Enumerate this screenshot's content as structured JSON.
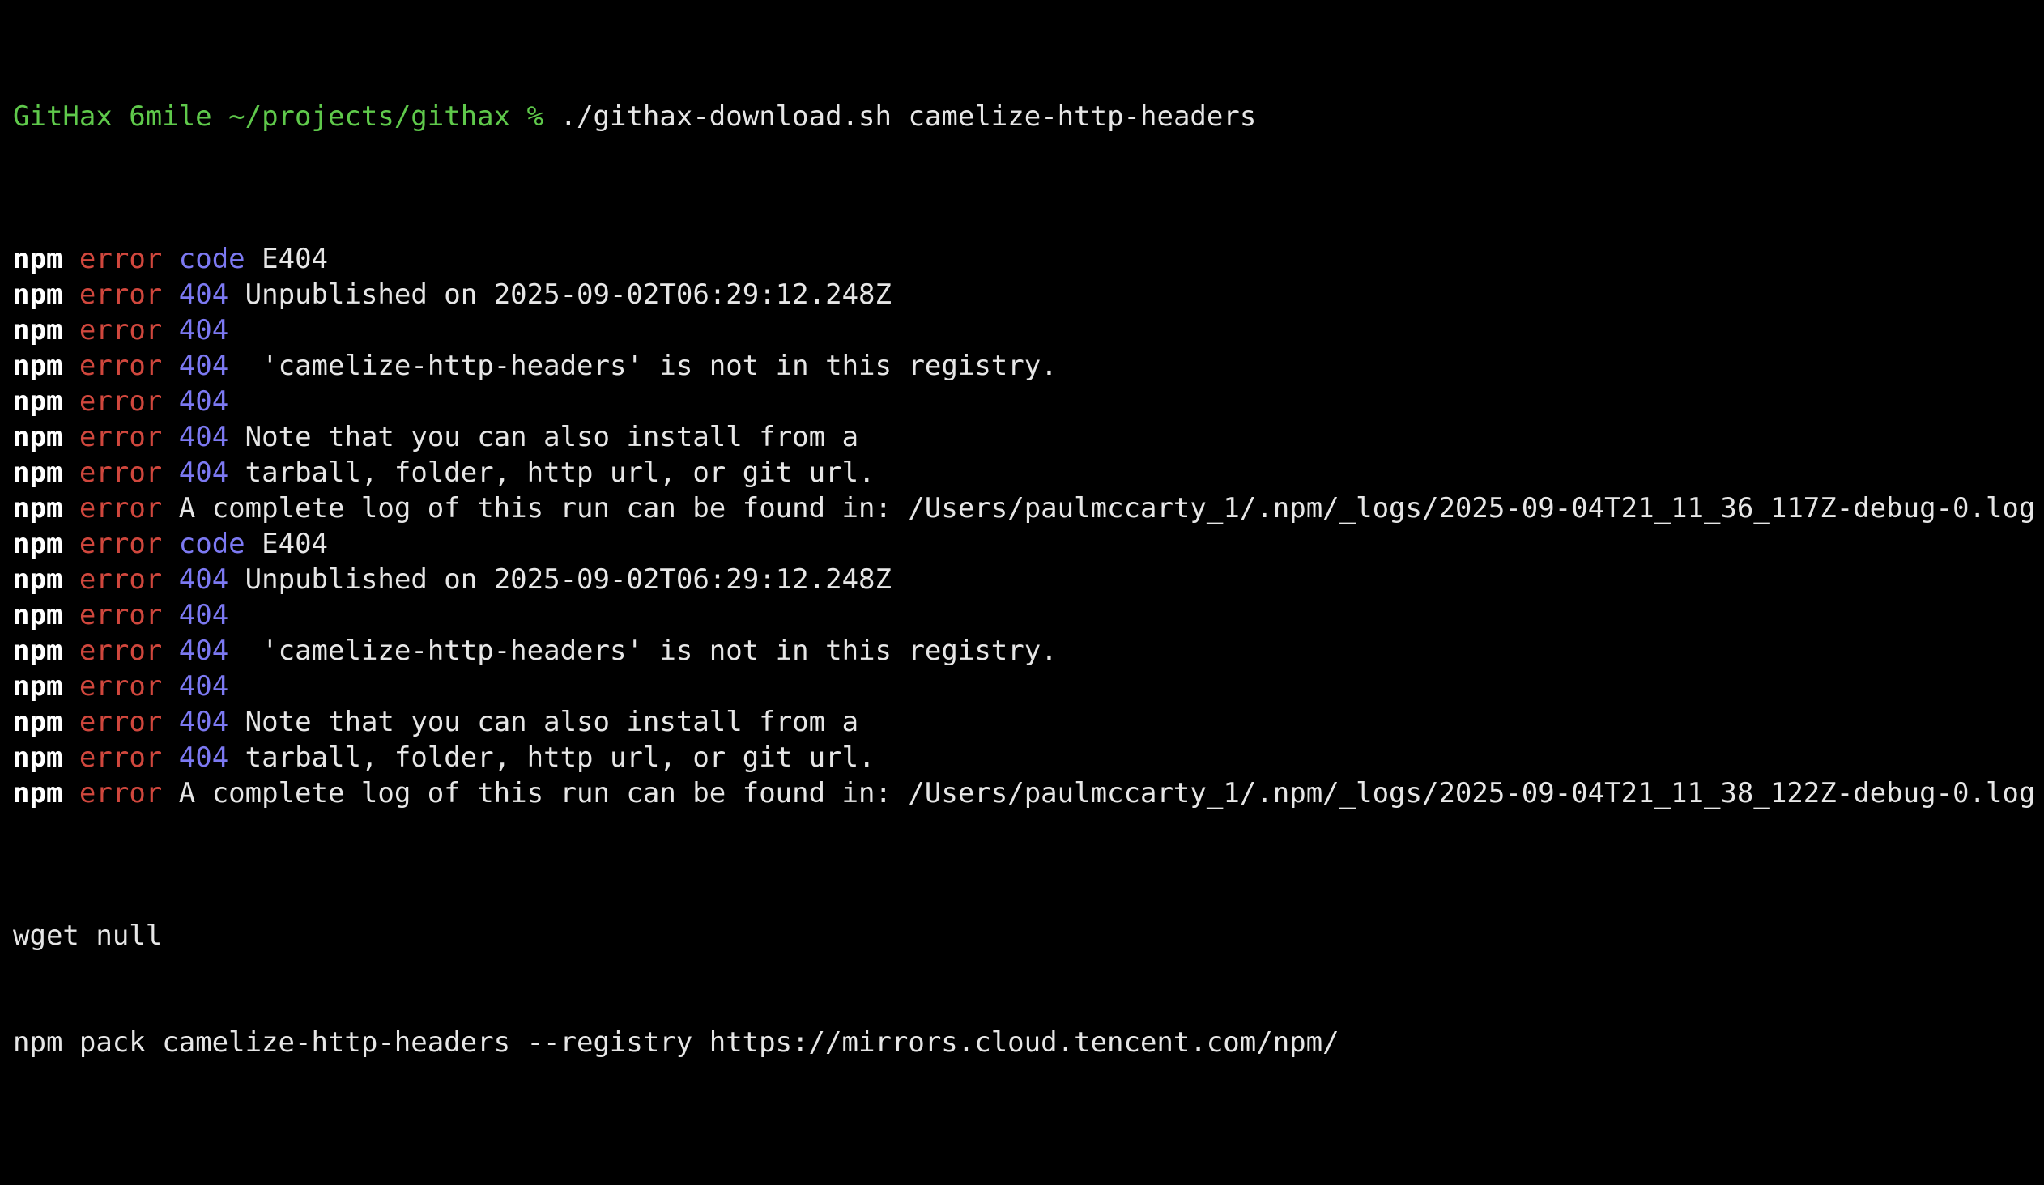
{
  "prompt": {
    "user_host": "GitHax 6mile",
    "path": "~/projects/githax",
    "symbol": "%",
    "command": "./githax-download.sh camelize-http-headers"
  },
  "tokens": {
    "npm": "npm",
    "error": "error"
  },
  "lines": [
    {
      "code": "code",
      "text": "E404"
    },
    {
      "code": "404",
      "text": "Unpublished on 2025-09-02T06:29:12.248Z"
    },
    {
      "code": "404",
      "text": ""
    },
    {
      "code": "404",
      "text": " 'camelize-http-headers' is not in this registry."
    },
    {
      "code": "404",
      "text": ""
    },
    {
      "code": "404",
      "text": "Note that you can also install from a"
    },
    {
      "code": "404",
      "text": "tarball, folder, http url, or git url."
    },
    {
      "code": "",
      "text": "A complete log of this run can be found in: /Users/paulmccarty_1/.npm/_logs/2025-09-04T21_11_36_117Z-debug-0.log"
    },
    {
      "code": "code",
      "text": "E404"
    },
    {
      "code": "404",
      "text": "Unpublished on 2025-09-02T06:29:12.248Z"
    },
    {
      "code": "404",
      "text": ""
    },
    {
      "code": "404",
      "text": " 'camelize-http-headers' is not in this registry."
    },
    {
      "code": "404",
      "text": ""
    },
    {
      "code": "404",
      "text": "Note that you can also install from a"
    },
    {
      "code": "404",
      "text": "tarball, folder, http url, or git url."
    },
    {
      "code": "",
      "text": "A complete log of this run can be found in: /Users/paulmccarty_1/.npm/_logs/2025-09-04T21_11_38_122Z-debug-0.log"
    }
  ],
  "tail": [
    "wget null",
    "npm pack camelize-http-headers --registry https://mirrors.cloud.tencent.com/npm/"
  ]
}
